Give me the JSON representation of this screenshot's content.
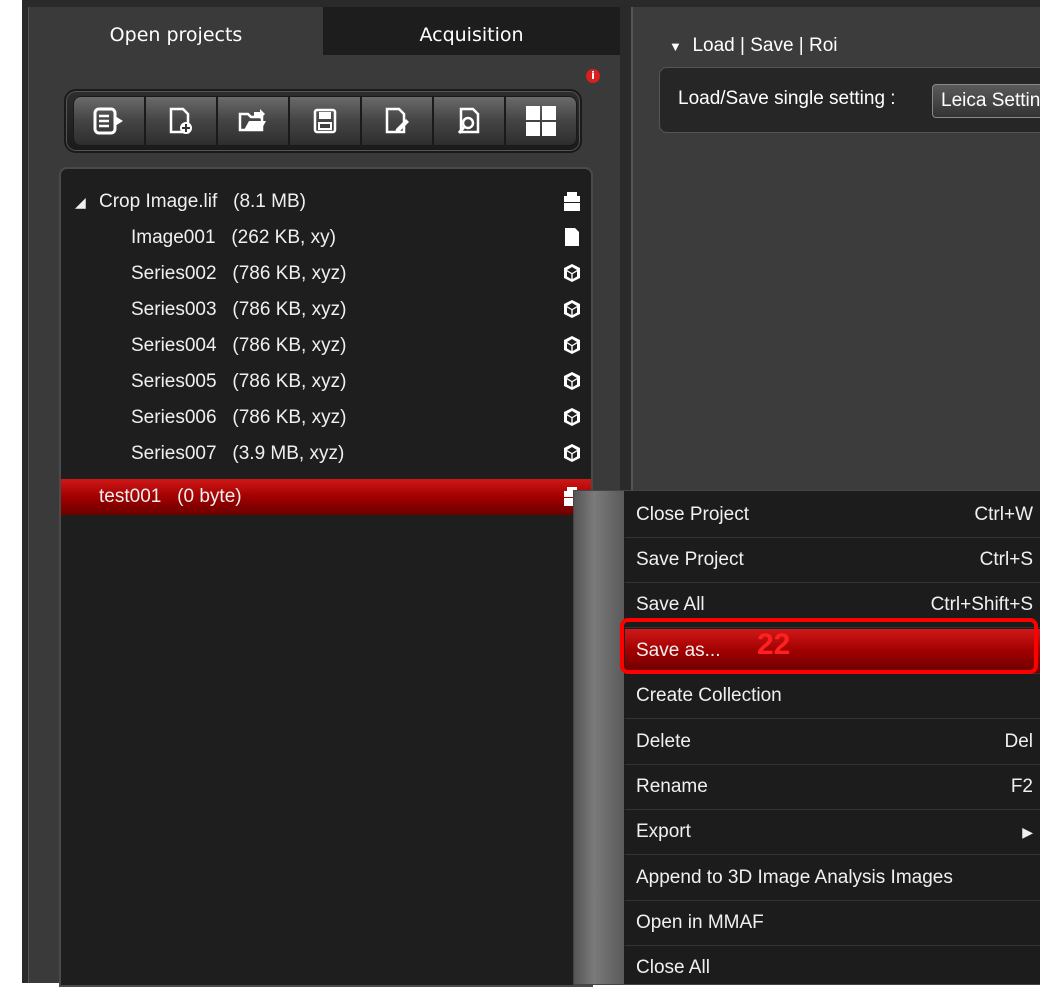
{
  "tabs": {
    "open_projects": "Open projects",
    "acquisition": "Acquisition"
  },
  "alert_badge": "i",
  "toolbar": {
    "buttons": [
      {
        "icon": "list-export-icon"
      },
      {
        "icon": "new-file-icon"
      },
      {
        "icon": "open-folder-icon"
      },
      {
        "icon": "save-icon"
      },
      {
        "icon": "edit-document-icon"
      },
      {
        "icon": "search-document-icon"
      },
      {
        "icon": "grid-view-icon"
      }
    ]
  },
  "tree": {
    "project1": {
      "label": "Crop Image.lif",
      "size": "(8.1 MB)",
      "expanded": true
    },
    "items": [
      {
        "name": "Image001",
        "info": "(262 KB, xy)",
        "icon": "image-icon"
      },
      {
        "name": "Series002",
        "info": "(786 KB, xyz)",
        "icon": "cube-icon"
      },
      {
        "name": "Series003",
        "info": "(786 KB, xyz)",
        "icon": "cube-icon"
      },
      {
        "name": "Series004",
        "info": "(786 KB, xyz)",
        "icon": "cube-icon"
      },
      {
        "name": "Series005",
        "info": "(786 KB, xyz)",
        "icon": "cube-icon"
      },
      {
        "name": "Series006",
        "info": "(786 KB, xyz)",
        "icon": "cube-icon"
      },
      {
        "name": "Series007",
        "info": "(3.9 MB, xyz)",
        "icon": "cube-icon"
      }
    ],
    "project2": {
      "label": "test001",
      "size": "(0 byte)",
      "selected": true
    }
  },
  "right": {
    "section_title": "Load | Save | Roi",
    "setting_label": "Load/Save single setting :",
    "setting_value": "Leica Settings"
  },
  "context_menu": {
    "items": [
      {
        "label": "Close Project",
        "shortcut": "Ctrl+W"
      },
      {
        "label": "Save Project",
        "shortcut": "Ctrl+S"
      },
      {
        "label": "Save All",
        "shortcut": "Ctrl+Shift+S"
      },
      {
        "label": "Save as...",
        "shortcut": "",
        "highlighted": true
      },
      {
        "label": "Create Collection",
        "shortcut": ""
      },
      {
        "label": "Delete",
        "shortcut": "Del"
      },
      {
        "label": "Rename",
        "shortcut": "F2"
      },
      {
        "label": "Export",
        "shortcut": "▶"
      },
      {
        "label": "Append to 3D Image Analysis Images",
        "shortcut": ""
      },
      {
        "label": "Open in MMAF",
        "shortcut": ""
      },
      {
        "label": "Close All",
        "shortcut": ""
      }
    ]
  },
  "annotation": {
    "step_number": "22"
  },
  "colors": {
    "selection_red": "#a00000",
    "highlight_frame": "#ff0000",
    "panel_bg": "#3a3a3a",
    "tree_bg": "#1e1e1e"
  }
}
